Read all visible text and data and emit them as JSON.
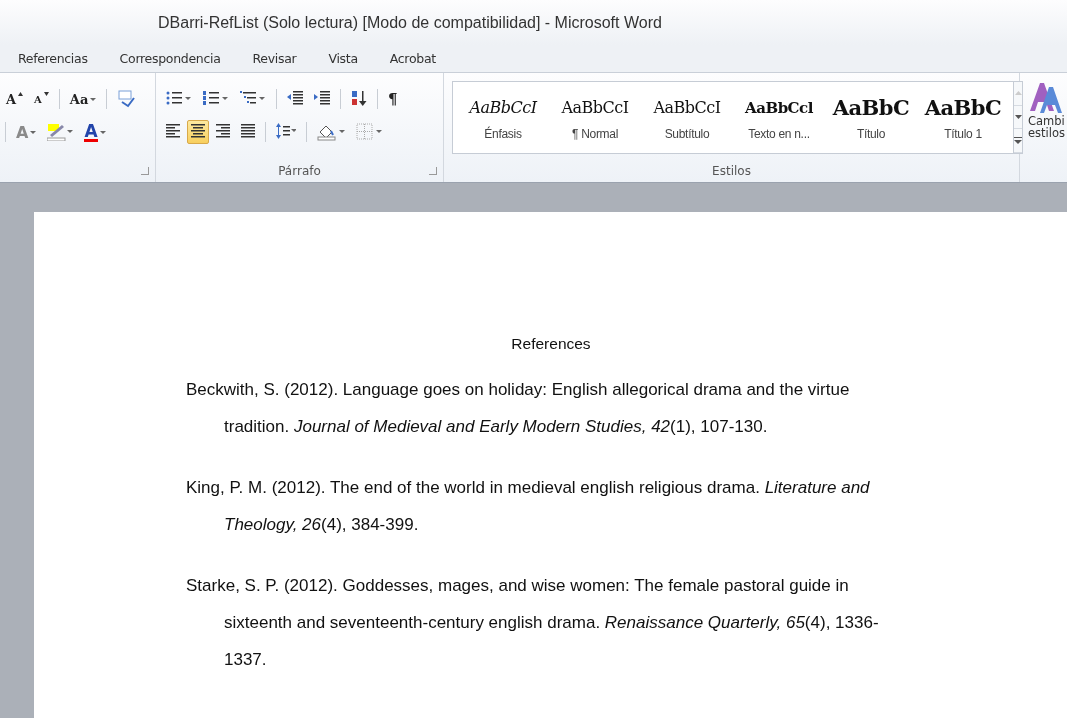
{
  "window": {
    "title": "DBarri-RefList (Solo lectura) [Modo de compatibilidad] - Microsoft Word"
  },
  "tabs": [
    {
      "label": "Referencias",
      "selected": false
    },
    {
      "label": "Correspondencia",
      "selected": false
    },
    {
      "label": "Revisar",
      "selected": false
    },
    {
      "label": "Vista",
      "selected": false
    },
    {
      "label": "Acrobat",
      "selected": false
    }
  ],
  "ribbon": {
    "font_group": {
      "row1": [
        {
          "kind": "grow",
          "glyph": "A"
        },
        {
          "kind": "shrink",
          "glyph": "A"
        },
        {
          "kind": "sep"
        },
        {
          "kind": "case",
          "glyph": "Aa"
        },
        {
          "kind": "sep"
        },
        {
          "kind": "clear"
        }
      ],
      "row2": [
        {
          "kind": "sep"
        },
        {
          "kind": "effects",
          "glyph": "A"
        },
        {
          "kind": "highlight"
        },
        {
          "kind": "color",
          "glyph": "A"
        }
      ]
    },
    "paragraph_group": {
      "label": "Párrafo",
      "row1": [
        {
          "kind": "bullets"
        },
        {
          "kind": "numbering"
        },
        {
          "kind": "multilevel"
        },
        {
          "kind": "sep"
        },
        {
          "kind": "outdent"
        },
        {
          "kind": "indent"
        },
        {
          "kind": "sep"
        },
        {
          "kind": "sort"
        },
        {
          "kind": "sep"
        },
        {
          "kind": "marks",
          "glyph": "¶"
        }
      ],
      "row2": [
        {
          "kind": "align-left",
          "selected": false
        },
        {
          "kind": "align-center",
          "selected": true
        },
        {
          "kind": "align-right",
          "selected": false
        },
        {
          "kind": "justify",
          "selected": false
        },
        {
          "kind": "sep"
        },
        {
          "kind": "spacing"
        },
        {
          "kind": "sep"
        },
        {
          "kind": "shading"
        },
        {
          "kind": "borders"
        }
      ]
    },
    "styles_group": {
      "label": "Estilos",
      "styles": [
        {
          "preview": "AaBbCcI",
          "name": "Énfasis",
          "kind": "emphasis"
        },
        {
          "preview": "AaBbCcI",
          "name": "¶ Normal",
          "kind": "normal"
        },
        {
          "preview": "AaBbCcI",
          "name": "Subtítulo",
          "kind": "subtitle"
        },
        {
          "preview": "AaBbCcl",
          "name": "Texto en n...",
          "kind": "strong"
        },
        {
          "preview": "AaBbC",
          "name": "Título",
          "kind": "title"
        },
        {
          "preview": "AaBbC",
          "name": "Título 1",
          "kind": "title"
        }
      ],
      "change_styles": {
        "line_1": "Cambi",
        "line_2": "estilos"
      }
    }
  },
  "document": {
    "heading": "References",
    "entries": [
      "Beckwith, S. (2012). Language goes on holiday: English allegorical drama and the virtue tradition. *Journal of Medieval and Early Modern Studies, 42*(1), 107-130.",
      "King, P. M. (2012). The end of the world in medieval english religious drama. *Literature and Theology, 26*(4), 384-399.",
      "Starke, S. P. (2012). Goddesses, mages, and wise women: The female pastoral guide in sixteenth and seventeenth-century english drama. *Renaissance Quarterly, 65*(4), 1336-1337."
    ]
  }
}
